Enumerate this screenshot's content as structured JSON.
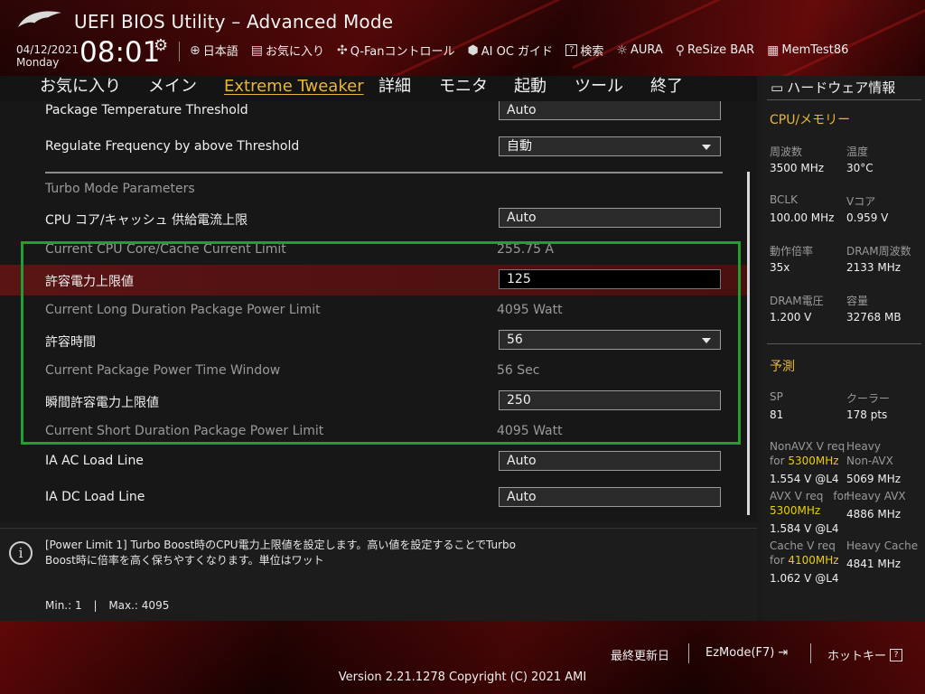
{
  "header": {
    "title": "UEFI BIOS Utility – Advanced Mode",
    "date": "04/12/2021",
    "day": "Monday",
    "time": "08:01",
    "toolbar": [
      {
        "icon": "globe-icon",
        "label": "日本語"
      },
      {
        "icon": "bookmark-icon",
        "label": "お気に入り"
      },
      {
        "icon": "fan-icon",
        "label": "Q-Fanコントロール"
      },
      {
        "icon": "ai-icon",
        "label": "AI OC ガイド"
      },
      {
        "icon": "help-icon",
        "label": "検索"
      },
      {
        "icon": "aura-icon",
        "label": "AURA"
      },
      {
        "icon": "resize-bar-icon",
        "label": "ReSize BAR"
      },
      {
        "icon": "memtest-icon",
        "label": "MemTest86"
      }
    ]
  },
  "menu": {
    "items": [
      "お気に入り",
      "メイン",
      "Extreme Tweaker",
      "詳細",
      "モニタ",
      "起動",
      "ツール",
      "終了"
    ],
    "active": "Extreme Tweaker"
  },
  "settings": {
    "pkg_temp_label": "Package Temperature Threshold",
    "pkg_temp_value": "Auto",
    "regulate_label": "Regulate Frequency by above Threshold",
    "regulate_value": "自動",
    "section_header": "Turbo Mode Parameters",
    "cpu_core_limit_label": "CPU コア/キャッシュ 供給電流上限",
    "cpu_core_limit_value": "Auto",
    "current_core_label": "Current CPU Core/Cache Current Limit",
    "current_core_value": "255.75 A",
    "power_limit_label": "許容電力上限値",
    "power_limit_value": "125",
    "current_long_label": "Current Long Duration Package Power Limit",
    "current_long_value": "4095 Watt",
    "time_window_label": "許容時間",
    "time_window_value": "56",
    "current_window_label": "Current Package Power Time Window",
    "current_window_value": "56 Sec",
    "short_limit_label": "瞬間許容電力上限値",
    "short_limit_value": "250",
    "current_short_label": "Current Short Duration Package Power Limit",
    "current_short_value": "4095 Watt",
    "ia_ac_label": "IA AC Load Line",
    "ia_ac_value": "Auto",
    "ia_dc_label": "IA DC Load Line",
    "ia_dc_value": "Auto"
  },
  "help": {
    "line1": "[Power Limit 1] Turbo Boost時のCPU電力上限値を設定します。高い値を設定することでTurbo",
    "line2": "Boost時に倍率を高く保ちやすくなります。単位はワット",
    "min": "Min.: 1",
    "sep": "|",
    "max": "Max.: 4095"
  },
  "hardware": {
    "title": "ハードウェア情報",
    "cpu_mem_title": "CPU/メモリー",
    "freq_k": "周波数",
    "freq_v": "3500 MHz",
    "temp_k": "温度",
    "temp_v": "30°C",
    "bclk_k": "BCLK",
    "bclk_v": "100.00 MHz",
    "vcore_k": "Vコア",
    "vcore_v": "0.959 V",
    "ratio_k": "動作倍率",
    "ratio_v": "35x",
    "dramfreq_k": "DRAM周波数",
    "dramfreq_v": "2133 MHz",
    "dramv_k": "DRAM電圧",
    "dramv_v": "1.200 V",
    "cap_k": "容量",
    "cap_v": "32768 MB",
    "pred_title": "予測",
    "sp_k": "SP",
    "sp_v": "81",
    "cooler_k": "クーラー",
    "cooler_v": "178 pts",
    "nonavx_k1": "NonAVX V req",
    "nonavx_k2": "for",
    "nonavx_freq": "5300MHz",
    "nonavx_v": "1.554 V @L4",
    "heavy_nonavx_k1": "Heavy",
    "heavy_nonavx_k2": "Non-AVX",
    "heavy_nonavx_v": "5069 MHz",
    "avx_k1": "AVX V req",
    "avx_k2": "for",
    "avx_freq": "5300MHz",
    "avx_v": "1.584 V @L4",
    "heavy_avx_k": "Heavy AVX",
    "heavy_avx_v": "4886 MHz",
    "cache_k1": "Cache V req",
    "cache_k2": "for",
    "cache_freq": "4100MHz",
    "cache_v": "1.062 V @L4",
    "heavy_cache_k": "Heavy Cache",
    "heavy_cache_v": "4841 MHz"
  },
  "footer": {
    "last_modified": "最終更新日",
    "ezmode": "EzMode(F7)",
    "hotkey": "ホットキー",
    "hotkey_icon": "?",
    "version": "Version 2.21.1278 Copyright (C) 2021 AMI"
  },
  "colors": {
    "accent": "#e8b73a",
    "highlight_row": "#5a1414",
    "annotation_box": "#21a02f",
    "yellow_value": "#e8d000"
  }
}
